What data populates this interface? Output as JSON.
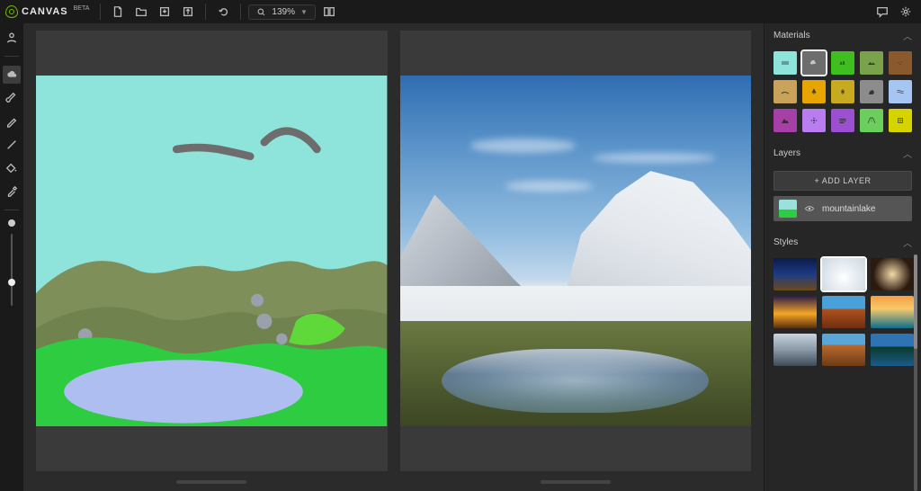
{
  "app": {
    "title": "CANVAS",
    "badge": "BETA"
  },
  "topbar": {
    "zoom": "139%",
    "icons": {
      "new": "new-file-icon",
      "open": "open-folder-icon",
      "save": "save-icon",
      "export": "export-icon",
      "undo": "undo-icon",
      "compare": "compare-icon",
      "feedback": "feedback-icon",
      "settings": "gear-icon"
    }
  },
  "tools": [
    {
      "id": "accounts",
      "icon": "user-icon",
      "active": false
    },
    {
      "id": "cloud",
      "icon": "cloud-icon",
      "active": true
    },
    {
      "id": "brush",
      "icon": "brush-icon",
      "active": false
    },
    {
      "id": "pencil",
      "icon": "pencil-icon",
      "active": false
    },
    {
      "id": "line",
      "icon": "line-icon",
      "active": false
    },
    {
      "id": "fill",
      "icon": "fill-icon",
      "active": false
    },
    {
      "id": "eyedrop",
      "icon": "eyedropper-icon",
      "active": false
    }
  ],
  "panels": {
    "materials": {
      "title": "Materials",
      "items": [
        {
          "id": "sky",
          "color": "#8ee3da",
          "selected": false
        },
        {
          "id": "cloud",
          "color": "#6d6d6d",
          "selected": true
        },
        {
          "id": "grass",
          "color": "#3fbf1f",
          "selected": false
        },
        {
          "id": "hill",
          "color": "#79a24a",
          "selected": false
        },
        {
          "id": "dirt",
          "color": "#8a5a2e",
          "selected": false
        },
        {
          "id": "sand",
          "color": "#c9a35a",
          "selected": false
        },
        {
          "id": "tree",
          "color": "#e6a500",
          "selected": false
        },
        {
          "id": "bush",
          "color": "#c8aa1f",
          "selected": false
        },
        {
          "id": "rock",
          "color": "#8c8c8c",
          "selected": false
        },
        {
          "id": "water",
          "color": "#a5c6f2",
          "selected": false
        },
        {
          "id": "mountain",
          "color": "#a63fa6",
          "selected": false
        },
        {
          "id": "flower",
          "color": "#b97df0",
          "selected": false
        },
        {
          "id": "fog",
          "color": "#9b4fd1",
          "selected": false
        },
        {
          "id": "road",
          "color": "#6ccf5d",
          "selected": false
        },
        {
          "id": "snow",
          "color": "#d6d400",
          "selected": false
        }
      ]
    },
    "layers": {
      "title": "Layers",
      "add_label": "+ ADD LAYER",
      "items": [
        {
          "name": "mountainlake",
          "visible": true
        }
      ]
    },
    "styles": {
      "title": "Styles",
      "selected_index": 1,
      "items": [
        "night-sky",
        "snow-mountain",
        "cave",
        "sunset-clouds",
        "desert-mesa",
        "ocean-sunset",
        "alpine",
        "canyon",
        "lake-valley"
      ]
    }
  }
}
